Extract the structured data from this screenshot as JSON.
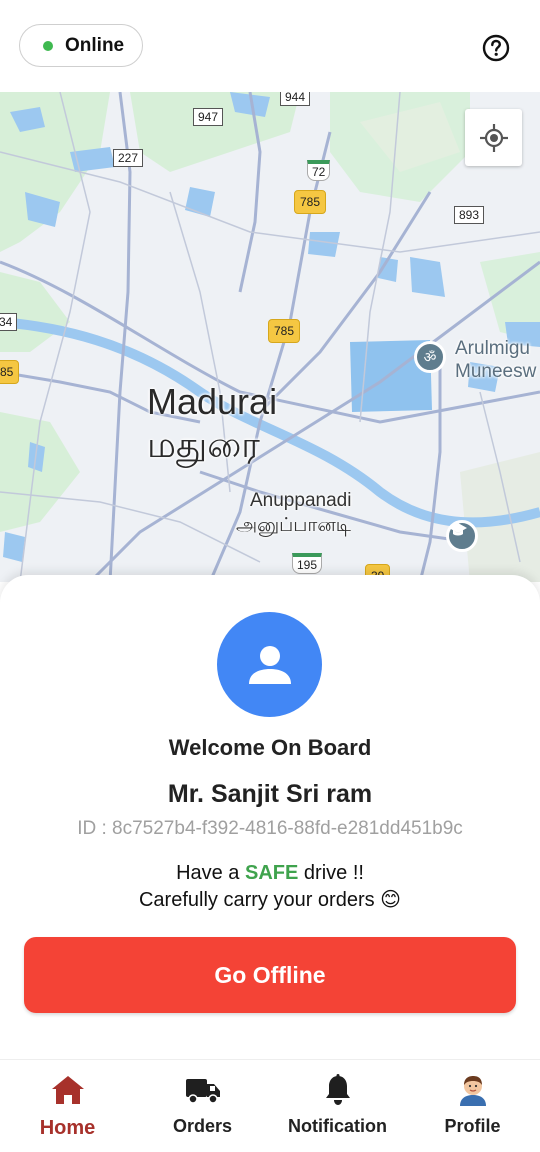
{
  "status": {
    "label": "Online",
    "dot_color": "#3fb950"
  },
  "header": {
    "help_icon": "help-circle-icon"
  },
  "map": {
    "city_name_en": "Madurai",
    "city_name_ta": "மதுரை",
    "area_name_en": "Anuppanadi",
    "area_name_ta": "அனுப்பானடி",
    "poi_label_line1": "Arulmigu",
    "poi_label_line2": "Muneesw",
    "road_labels": [
      "944",
      "947",
      "227",
      "72",
      "785",
      "893",
      "34",
      "785",
      "85",
      "195",
      "39"
    ],
    "locate_icon": "my-location-icon"
  },
  "welcome": {
    "title": "Welcome On Board",
    "name": "Mr. Sanjit Sri ram",
    "id_text": "ID : 8c7527b4-f392-4816-88fd-e281dd451b9c",
    "msg_prefix": "Have a",
    "msg_safe": "SAFE",
    "msg_suffix": "drive  !!",
    "msg_line2": "Carefully carry your orders 😊",
    "avatar_color": "#4287f5"
  },
  "actions": {
    "go_offline_label": "Go Offline",
    "go_offline_color": "#f44336"
  },
  "nav": {
    "items": [
      {
        "label": "Home",
        "icon": "home-icon",
        "active": true
      },
      {
        "label": "Orders",
        "icon": "truck-icon"
      },
      {
        "label": "Notification",
        "icon": "bell-icon"
      },
      {
        "label": "Profile",
        "icon": "profile-avatar-icon"
      }
    ],
    "active_color": "#a7312b"
  }
}
